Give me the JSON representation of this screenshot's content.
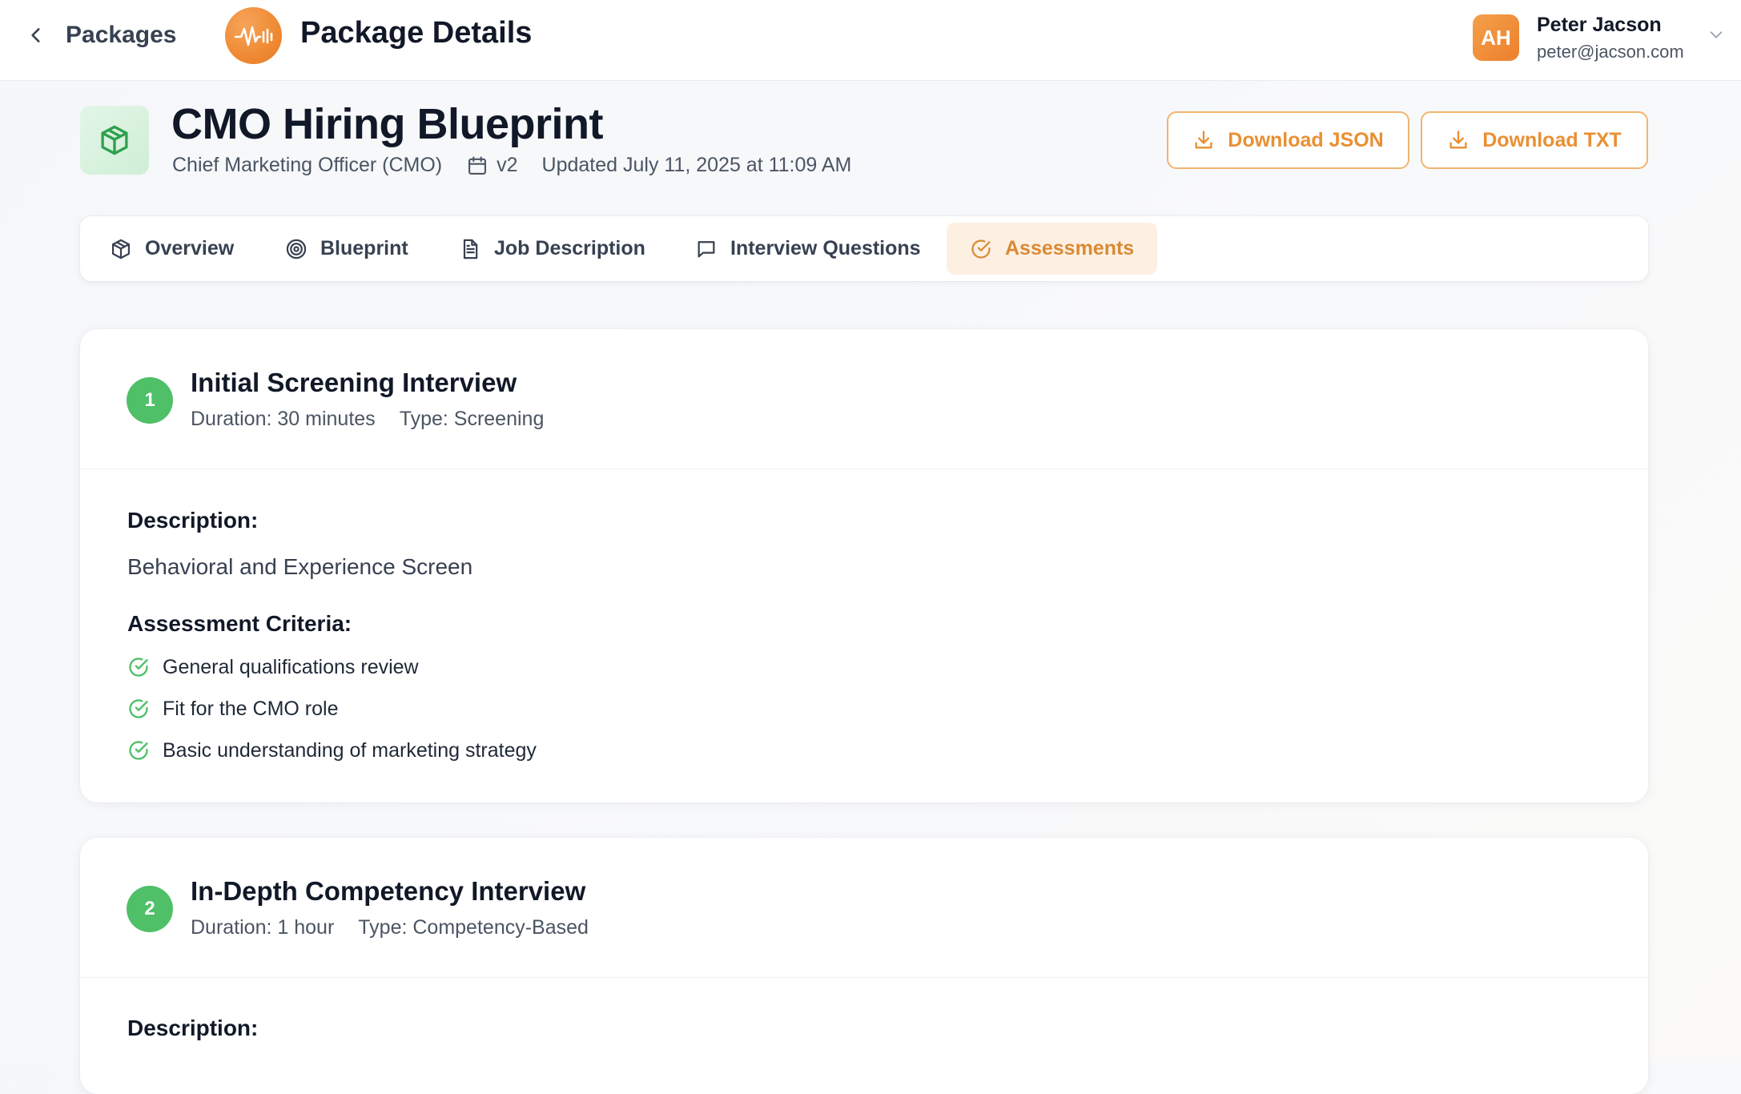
{
  "topbar": {
    "back_label": "Packages",
    "page_title": "Package Details",
    "user": {
      "initials": "AH",
      "name": "Peter Jacson",
      "email": "peter@jacson.com"
    }
  },
  "package": {
    "title": "CMO Hiring Blueprint",
    "role": "Chief Marketing Officer (CMO)",
    "version": "v2",
    "updated": "Updated July 11, 2025 at 11:09 AM"
  },
  "actions": {
    "download_json": "Download JSON",
    "download_txt": "Download TXT"
  },
  "tabs": [
    {
      "label": "Overview",
      "icon": "cube-icon"
    },
    {
      "label": "Blueprint",
      "icon": "target-icon"
    },
    {
      "label": "Job Description",
      "icon": "document-icon"
    },
    {
      "label": "Interview Questions",
      "icon": "chat-icon"
    },
    {
      "label": "Assessments",
      "icon": "check-circle-icon",
      "active": true
    }
  ],
  "assessments": [
    {
      "number": "1",
      "title": "Initial Screening Interview",
      "duration": "Duration: 30 minutes",
      "type": "Type: Screening",
      "description_label": "Description:",
      "description": "Behavioral and Experience Screen",
      "criteria_label": "Assessment Criteria:",
      "criteria": [
        "General qualifications review",
        "Fit for the CMO role",
        "Basic understanding of marketing strategy"
      ]
    },
    {
      "number": "2",
      "title": "In-Depth Competency Interview",
      "duration": "Duration: 1 hour",
      "type": "Type: Competency-Based",
      "description_label": "Description:"
    }
  ],
  "colors": {
    "accent": "#ea8f32",
    "accent_bg": "#fdf0e2",
    "success": "#4fbf68",
    "package_icon_bg": "#d9f2df"
  }
}
